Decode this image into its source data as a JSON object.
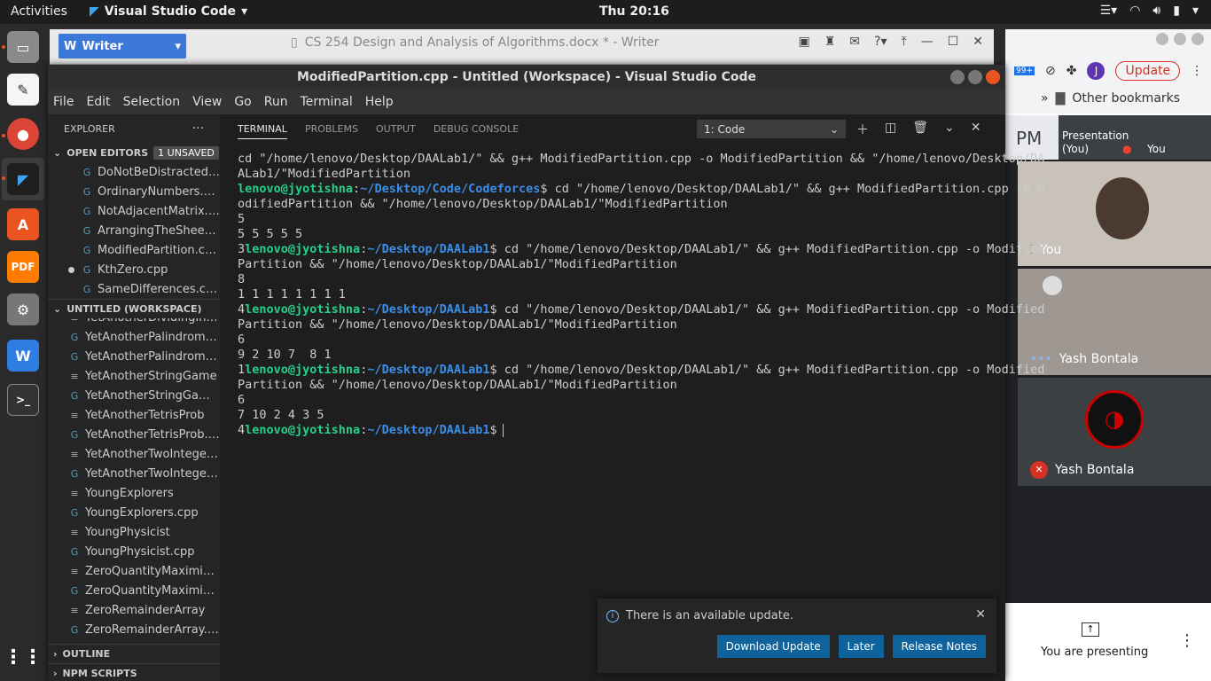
{
  "topbar": {
    "activities": "Activities",
    "app_name": "Visual Studio Code",
    "clock": "Thu 20:16"
  },
  "writer": {
    "app_label": "Writer",
    "title": "CS 254 Design and Analysis of Algorithms.docx * - Writer"
  },
  "chrome": {
    "update_label": "Update",
    "avatar_letter": "J",
    "ext_badge": "99+",
    "bookmarks_chevron": "»",
    "other_bookmarks": "Other bookmarks",
    "meet": {
      "pm": "PM",
      "presentation_line1": "Presentation",
      "presentation_line2": "(You)",
      "self_small": "You",
      "tiles": [
        "You",
        "Yash Bontala",
        "Yash Bontala"
      ],
      "presenting": "You are presenting"
    }
  },
  "vscode": {
    "title": "ModifiedPartition.cpp - Untitled (Workspace) - Visual Studio Code",
    "menu": [
      "File",
      "Edit",
      "Selection",
      "View",
      "Go",
      "Run",
      "Terminal",
      "Help"
    ],
    "explorer_title": "EXPLORER",
    "open_editors": {
      "label": "OPEN EDITORS",
      "badge": "1 UNSAVED",
      "files": [
        "DoNotBeDistracted.c...",
        "OrdinaryNumbers.cpp",
        "NotAdjacentMatrix.cpp",
        "ArrangingTheSheep....",
        "ModifiedPartition.cp...",
        "KthZero.cpp",
        "SameDifferences.cpp"
      ]
    },
    "workspace": {
      "label": "UNTITLED (WORKSPACE)",
      "files": [
        {
          "name": "YetAnotherDividingInt...",
          "type": "plain"
        },
        {
          "name": "YetAnotherPalindrome...",
          "type": "cpp"
        },
        {
          "name": "YetAnotherPalindrome...",
          "type": "cpp"
        },
        {
          "name": "YetAnotherStringGame",
          "type": "plain"
        },
        {
          "name": "YetAnotherStringGame...",
          "type": "cpp"
        },
        {
          "name": "YetAnotherTetrisProb",
          "type": "plain"
        },
        {
          "name": "YetAnotherTetrisProb.c...",
          "type": "cpp"
        },
        {
          "name": "YetAnotherTwoInteger...",
          "type": "plain"
        },
        {
          "name": "YetAnotherTwoInteger...",
          "type": "cpp"
        },
        {
          "name": "YoungExplorers",
          "type": "plain"
        },
        {
          "name": "YoungExplorers.cpp",
          "type": "cpp"
        },
        {
          "name": "YoungPhysicist",
          "type": "plain"
        },
        {
          "name": "YoungPhysicist.cpp",
          "type": "cpp"
        },
        {
          "name": "ZeroQuantityMaximizat...",
          "type": "plain"
        },
        {
          "name": "ZeroQuantityMaximizat...",
          "type": "cpp"
        },
        {
          "name": "ZeroRemainderArray",
          "type": "plain"
        },
        {
          "name": "ZeroRemainderArray.cpp",
          "type": "cpp"
        }
      ]
    },
    "outline": "OUTLINE",
    "npm_scripts": "NPM SCRIPTS",
    "panel_tabs": [
      "TERMINAL",
      "PROBLEMS",
      "OUTPUT",
      "DEBUG CONSOLE"
    ],
    "terminal_select": "1: Code",
    "terminal": {
      "line0": "cd \"/home/lenovo/Desktop/DAALab1/\" && g++ ModifiedPartition.cpp -o ModifiedPartition && \"/home/lenovo/Desktop/DAALab1/\"ModifiedPartition",
      "user": "lenovo@jyotishna",
      "path_codeforces": "~/Desktop/Code/Codeforces",
      "path_daalab": "~/Desktop/DAALab1",
      "cmd": "cd \"/home/lenovo/Desktop/DAALab1/\" && g++ ModifiedPartition.cpp -o ModifiedPartition && \"/home/lenovo/Desktop/DAALab1/\"ModifiedPartition",
      "runs": [
        {
          "n": "5",
          "arr": "5 5 5 5 5",
          "out": "3"
        },
        {
          "n": "8",
          "arr": "1 1 1 1 1 1 1 1",
          "out": "4"
        },
        {
          "n": "6",
          "arr": "9 2 10 7  8 1",
          "out": "1"
        },
        {
          "n": "6",
          "arr": "7 10 2 4 3 5",
          "out": "4"
        }
      ]
    },
    "notification": {
      "message": "There is an available update.",
      "buttons": [
        "Download Update",
        "Later",
        "Release Notes"
      ]
    }
  }
}
